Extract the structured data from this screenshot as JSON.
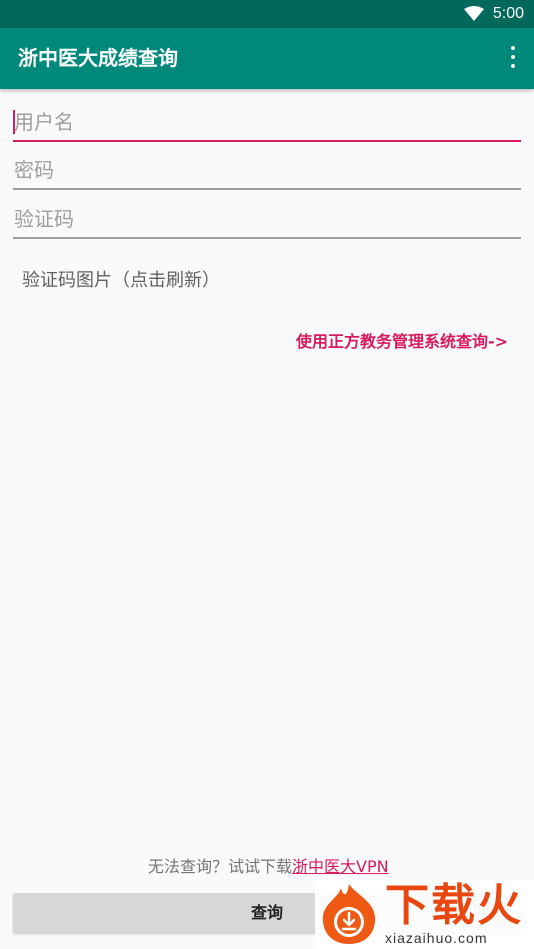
{
  "status_bar": {
    "time": "5:00",
    "icon": "wifi-icon"
  },
  "app_bar": {
    "title": "浙中医大成绩查询",
    "menu_icon": "more-vert-icon"
  },
  "form": {
    "username": {
      "placeholder": "用户名",
      "value": ""
    },
    "password": {
      "placeholder": "密码",
      "value": ""
    },
    "captcha": {
      "placeholder": "验证码",
      "value": ""
    },
    "captcha_image_label": "验证码图片（点击刷新）"
  },
  "zf_link": "使用正方教务管理系统查询->",
  "hint": {
    "text": "无法查询？试试下载",
    "link": "浙中医大VPN"
  },
  "query_button": "查询",
  "watermark": {
    "text": "下载火",
    "url": "xiazaihuo.com"
  },
  "colors": {
    "status_bar": "#00695c",
    "app_bar": "#00897b",
    "accent": "#d81b60",
    "button": "#d6d7d7"
  }
}
